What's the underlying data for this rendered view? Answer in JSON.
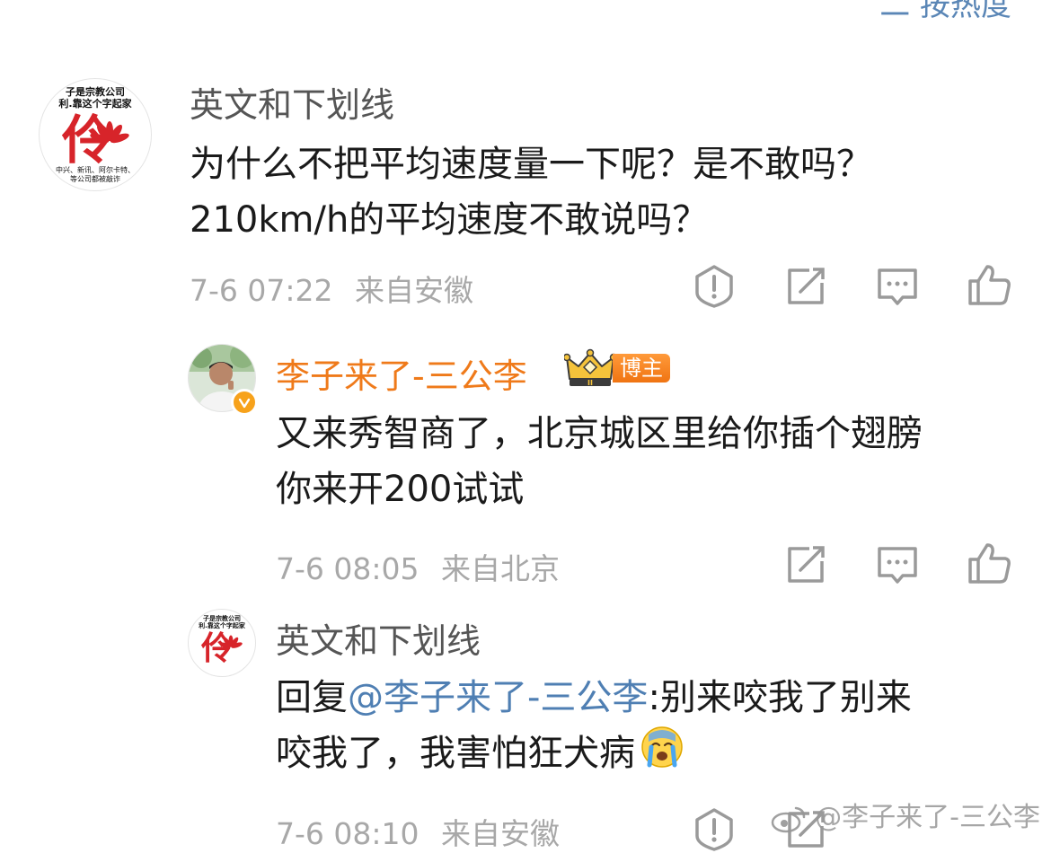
{
  "header": {
    "sort_label": "二 按热度"
  },
  "comment": {
    "username": "英文和下划线",
    "text_line1": "为什么不把平均速度量一下呢？是不敢吗？",
    "text_line2": "210km/h的平均速度不敢说吗？",
    "date": "7-6 07:22",
    "location": "来自安徽",
    "avatar_text_top": "子是宗教公司",
    "avatar_text_mid": "利.靠这个字起家",
    "avatar_glyph": "伶",
    "avatar_text_bottom": "中兴、新讯、阿尔卡特、",
    "avatar_text_bottom2": "等公司都被敲诈"
  },
  "reply1": {
    "username": "李子来了-三公李",
    "badge_level": "II",
    "badge_label": "博主",
    "text_line1": "又来秀智商了，北京城区里给你插个翅膀",
    "text_line2": "你来开200试试",
    "date": "7-6 08:05",
    "location": "来自北京"
  },
  "reply2": {
    "username": "英文和下划线",
    "reply_prefix": "回复",
    "mention": "@李子来了-三公李",
    "text_after_mention": ":别来咬我了别来",
    "text_line2": "咬我了，我害怕狂犬病",
    "date": "7-6 08:10",
    "location": "来自安徽",
    "emoji": "crying-face",
    "avatar_text_top": "子是宗教公司",
    "avatar_text_mid": "利.靠这个字起家",
    "avatar_glyph": "伶"
  },
  "watermark": "@李子来了-三公李",
  "colors": {
    "username_gray": "#555555",
    "blogger_orange": "#ef7a1a",
    "mention_blue": "#4f7fb3",
    "meta_gray": "#a8a8a8",
    "icon_gray": "#9a9a9a",
    "avatar_red": "#d7242a"
  }
}
